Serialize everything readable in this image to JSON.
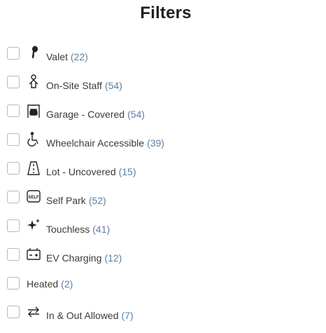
{
  "title": "Filters",
  "accent_color": "#5b7fa6",
  "filters": [
    {
      "label": "Valet",
      "count": "(22)",
      "icon": "key-icon"
    },
    {
      "label": "On-Site Staff",
      "count": "(54)",
      "icon": "person-icon"
    },
    {
      "label": "Garage - Covered",
      "count": "(54)",
      "icon": "garage-icon"
    },
    {
      "label": "Wheelchair Accessible",
      "count": "(39)",
      "icon": "wheelchair-icon"
    },
    {
      "label": "Lot - Uncovered",
      "count": "(15)",
      "icon": "road-icon"
    },
    {
      "label": "Self Park",
      "count": "(52)",
      "icon": "self-park-icon",
      "icon_text": "SELF"
    },
    {
      "label": "Touchless",
      "count": "(41)",
      "icon": "sparkle-icon"
    },
    {
      "label": "EV Charging",
      "count": "(12)",
      "icon": "battery-icon"
    },
    {
      "label": "Heated",
      "count": "(2)",
      "icon": ""
    },
    {
      "label": "In & Out Allowed",
      "count": "(7)",
      "icon": "in-out-arrows-icon"
    }
  ]
}
